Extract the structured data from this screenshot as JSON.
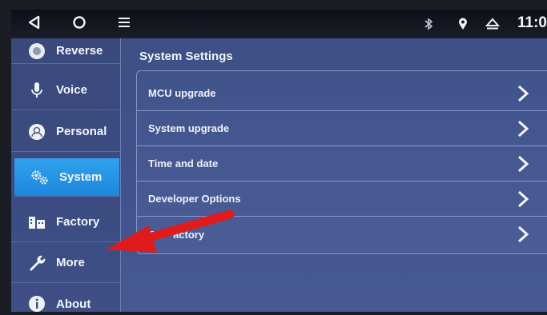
{
  "status_bar": {
    "nav_back_icon": "back-triangle-icon",
    "nav_home_icon": "home-circle-icon",
    "nav_menu_icon": "menu-icon",
    "bluetooth_icon": "bluetooth-icon",
    "location_icon": "location-pin-icon",
    "eject_icon": "eject-icon",
    "time": "11:0"
  },
  "sidebar": {
    "items": [
      {
        "label": "Reverse",
        "icon": "camera-icon"
      },
      {
        "label": "Voice",
        "icon": "microphone-icon"
      },
      {
        "label": "Personal",
        "icon": "user-icon"
      },
      {
        "label": "System",
        "icon": "gears-icon",
        "active": true
      },
      {
        "label": "Factory",
        "icon": "factory-icon"
      },
      {
        "label": "More",
        "icon": "wrench-icon"
      },
      {
        "label": "About",
        "icon": "info-icon"
      }
    ]
  },
  "main": {
    "title": "System Settings",
    "rows": [
      {
        "label": "MCU upgrade"
      },
      {
        "label": "System upgrade"
      },
      {
        "label": "Time and date"
      },
      {
        "label": "Developer Options"
      },
      {
        "label": "Re    actory"
      }
    ]
  },
  "colors": {
    "accent": "#2196e8",
    "background": "#3f5188",
    "annotation_arrow": "#e01b1b"
  }
}
